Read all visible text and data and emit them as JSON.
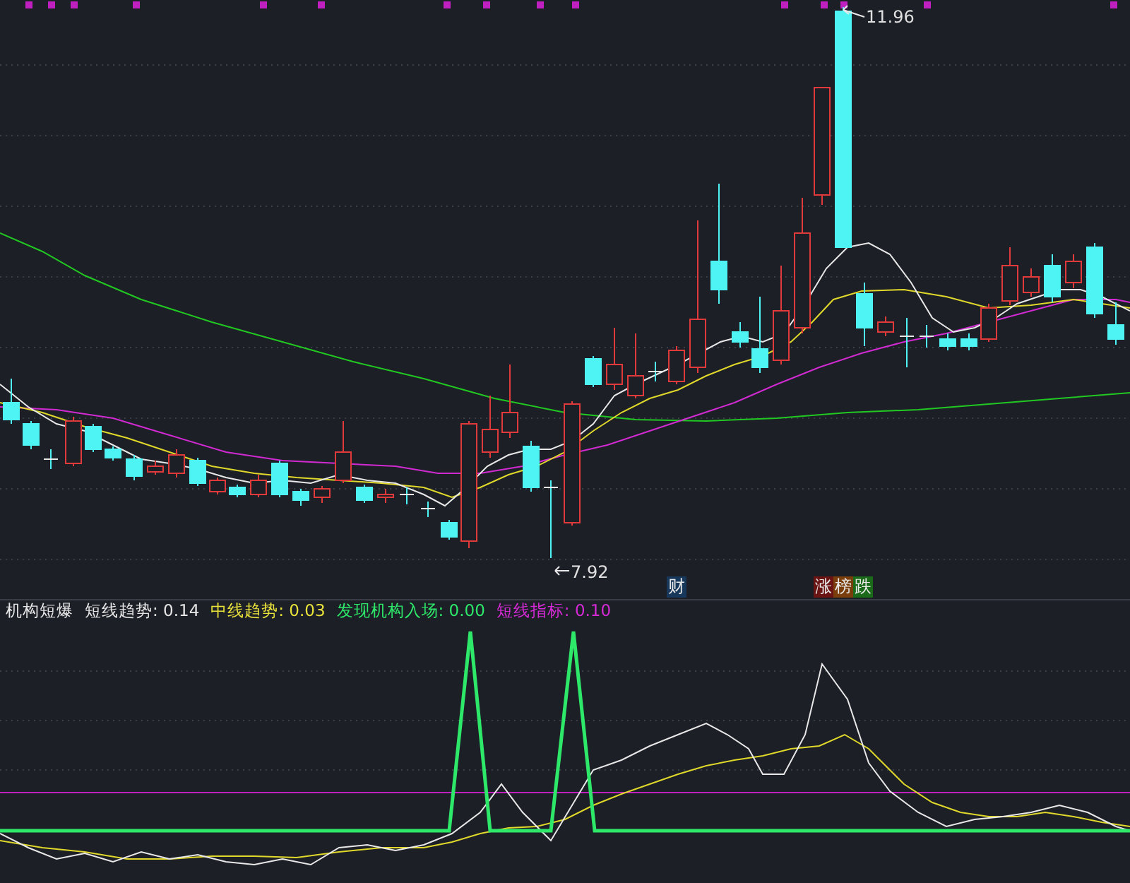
{
  "main_chart": {
    "high_label": "11.96",
    "low_label": "7.92",
    "news_markers": [
      {
        "text": "财",
        "color": "#17385a"
      }
    ],
    "rank_markers": [
      {
        "text": "涨",
        "color": "#6a1414"
      },
      {
        "text": "榜",
        "color": "#7a3d0c"
      },
      {
        "text": "跌",
        "color": "#1a6a1a"
      }
    ]
  },
  "indicator": {
    "name": "机构短爆",
    "items": [
      {
        "label": "短线趋势:",
        "value": "0.14",
        "color": "#e6e6e6"
      },
      {
        "label": "中线趋势:",
        "value": "0.03",
        "color": "#e8e23a"
      },
      {
        "label": "发现机构入场:",
        "value": "0.00",
        "color": "#2ee86a"
      },
      {
        "label": "短线指标:",
        "value": "0.10",
        "color": "#d62ad6"
      }
    ]
  }
}
